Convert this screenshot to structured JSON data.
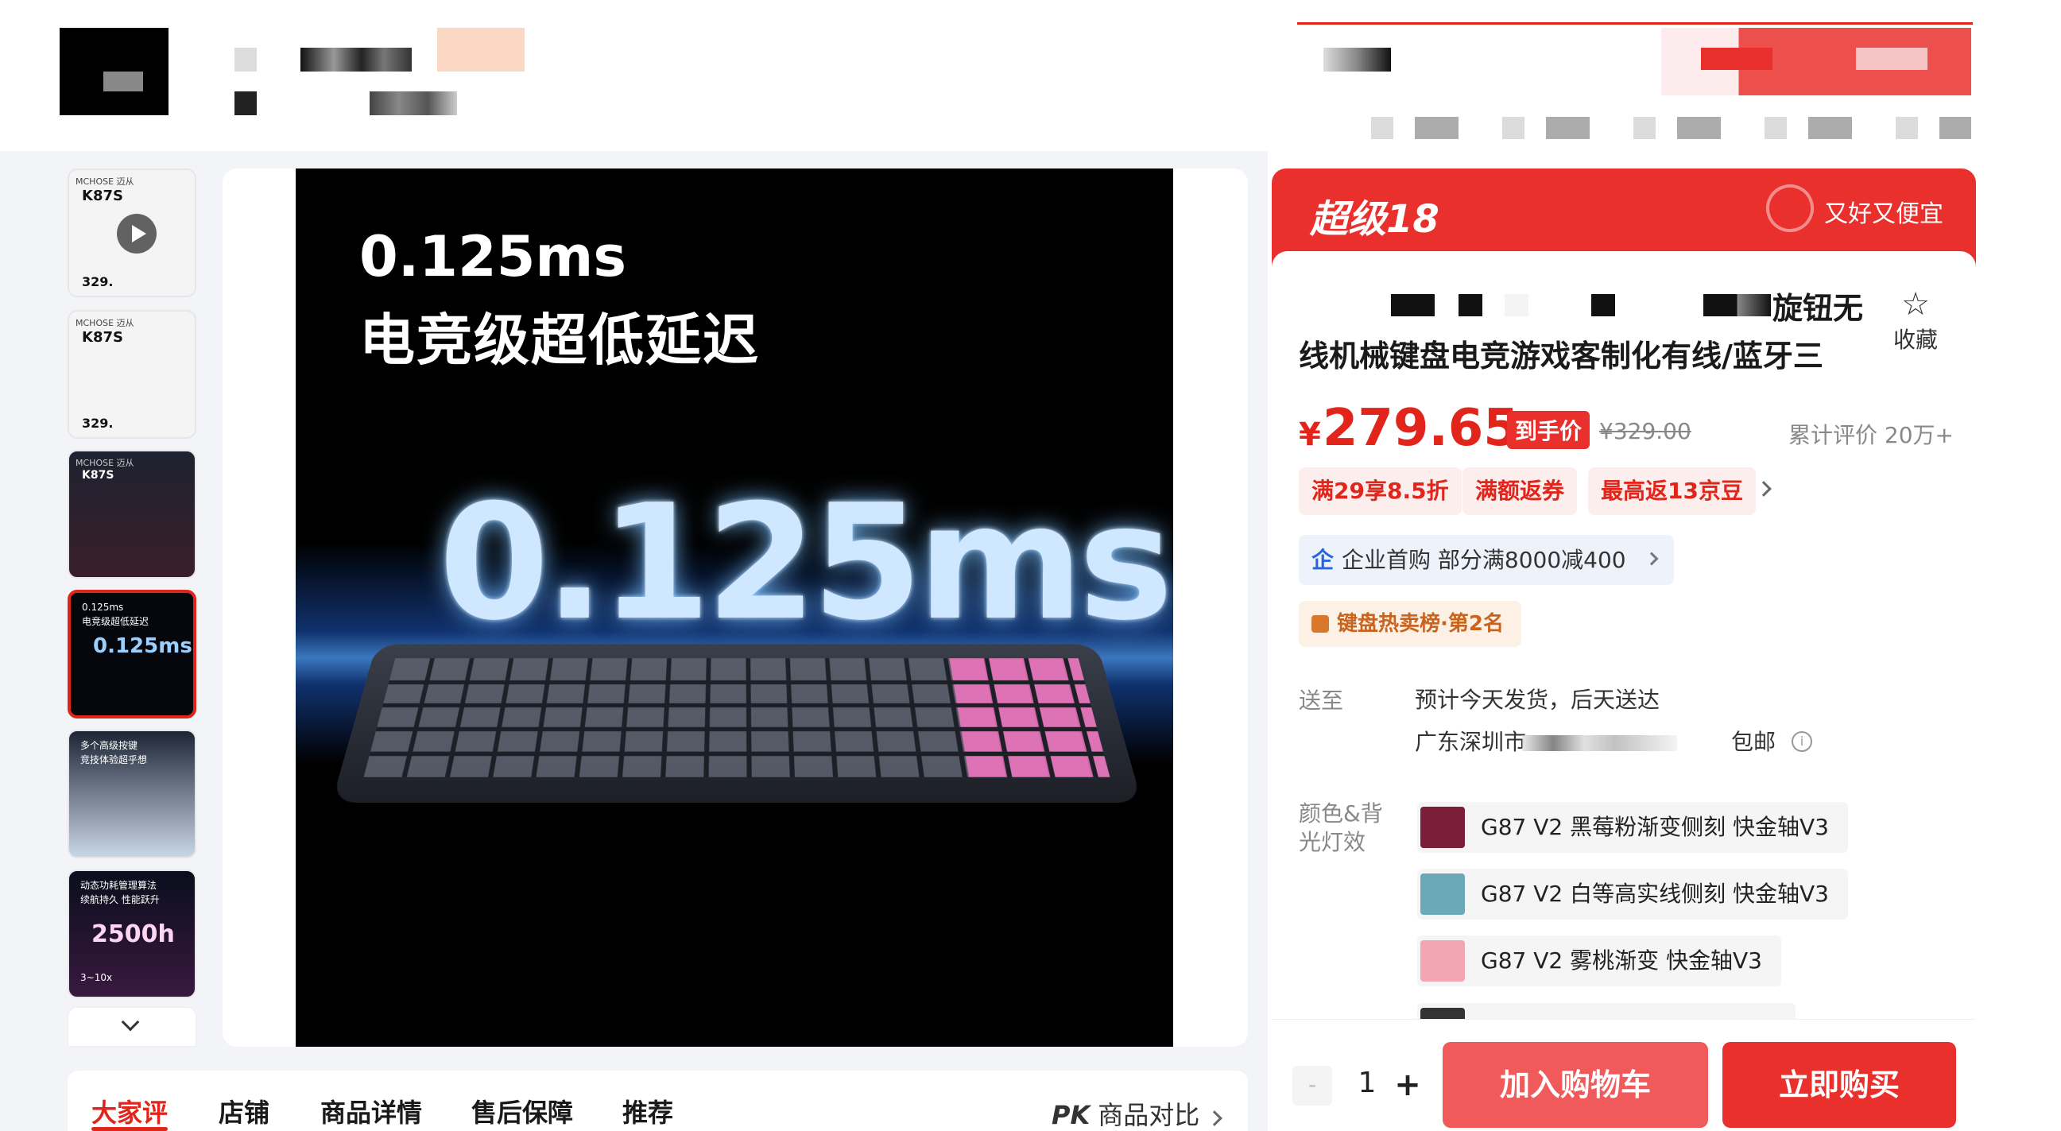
{
  "gallery": {
    "thumbs": [
      {
        "brand": "MCHOSE 迈从",
        "name": "K87S",
        "price": "329."
      },
      {
        "brand": "MCHOSE 迈从",
        "name": "K87S",
        "price": "329."
      },
      {
        "brand": "MCHOSE 迈从",
        "name": "K87S"
      },
      {
        "line1": "0.125ms",
        "line2": "电竞级超低延迟",
        "big": "0.125ms"
      },
      {
        "line1": "多个高级按键",
        "line2": "竞技体验超乎想"
      },
      {
        "line1": "动态功耗管理算法",
        "line2": "续航持久 性能跃升",
        "big": "2500h",
        "sub": "3~10x"
      }
    ],
    "main_image": {
      "line1": "0.125ms",
      "line2": "电竞级超低延迟",
      "big": "0.125ms"
    }
  },
  "tabs": [
    {
      "label": "大家评"
    },
    {
      "label": "店铺"
    },
    {
      "label": "商品详情"
    },
    {
      "label": "售后保障"
    },
    {
      "label": "推荐"
    }
  ],
  "compare": {
    "prefix": "PK",
    "label": "商品对比"
  },
  "promo": {
    "title": "超级18",
    "tagline": "又好又便宜"
  },
  "product": {
    "title_line1": "旋钮无",
    "title_line2": "线机械键盘电竞游戏客制化有线/蓝牙三",
    "favorite": "收藏",
    "currency": "¥",
    "price": "279.65",
    "price_tag": "到手价",
    "old_price": "¥329.00",
    "reviews": "累计评价 20万+"
  },
  "chips": [
    "满29享8.5折",
    "满额返券",
    "最高返13京豆"
  ],
  "corp": {
    "icon": "企",
    "text": "企业首购 部分满8000减400"
  },
  "rank": {
    "text": "键盘热卖榜·第2名"
  },
  "shipping": {
    "label": "送至",
    "eta": "预计今天发货，后天送达",
    "address": "广东深圳市",
    "free": "包邮"
  },
  "color": {
    "label_line1": "颜色&背",
    "label_line2": "光灯效",
    "options": [
      {
        "label": "G87 V2 黑莓粉渐变侧刻 快金轴V3",
        "swatch": "#7a1e3a"
      },
      {
        "label": "G87 V2 白等高实线侧刻 快金轴V3",
        "swatch": "#6aa9b8"
      },
      {
        "label": "G87 V2 雾桃渐变 快金轴V3",
        "swatch": "#f2a6b4"
      }
    ]
  },
  "cart": {
    "minus": "-",
    "qty": "1",
    "plus": "+",
    "add_to_cart": "加入购物车",
    "buy_now": "立即购买"
  },
  "colors": {
    "accent": "#e1251b",
    "promo": "#e9302c",
    "cart": "#f05a5a"
  }
}
